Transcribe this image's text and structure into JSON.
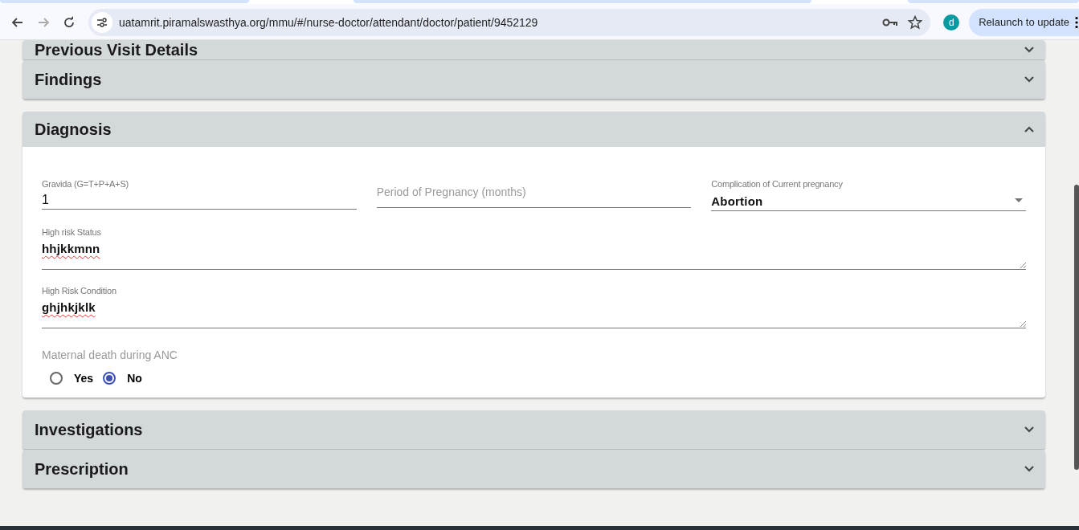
{
  "browser": {
    "url": "uatamrit.piramalswasthya.org/mmu/#/nurse-doctor/attendant/doctor/patient/9452129",
    "profile_initial": "d",
    "update_button": "Relaunch to update"
  },
  "panels": [
    {
      "title": "Previous Visit Details",
      "expanded": false
    },
    {
      "title": "Findings",
      "expanded": false
    },
    {
      "title": "Diagnosis",
      "expanded": true,
      "fields": [
        {
          "kind": "input",
          "label": "Gravida (G=T+P+A+S)",
          "value": "1"
        },
        {
          "kind": "input",
          "placeholder": "Period of Pregnancy (months)"
        },
        {
          "kind": "select",
          "label": "Complication of Current pregnancy",
          "value": "Abortion"
        },
        {
          "kind": "textarea",
          "label": "High risk Status",
          "value": "hhjkkmnn"
        },
        {
          "kind": "textarea",
          "label": "High Risk Condition",
          "value": "ghjhkjklk"
        }
      ],
      "radio": {
        "label": "Maternal death during ANC",
        "options": [
          {
            "label": "Yes",
            "selected": false
          },
          {
            "label": "No",
            "selected": true
          }
        ]
      }
    },
    {
      "title": "Investigations",
      "expanded": false
    },
    {
      "title": "Prescription",
      "expanded": false
    }
  ]
}
